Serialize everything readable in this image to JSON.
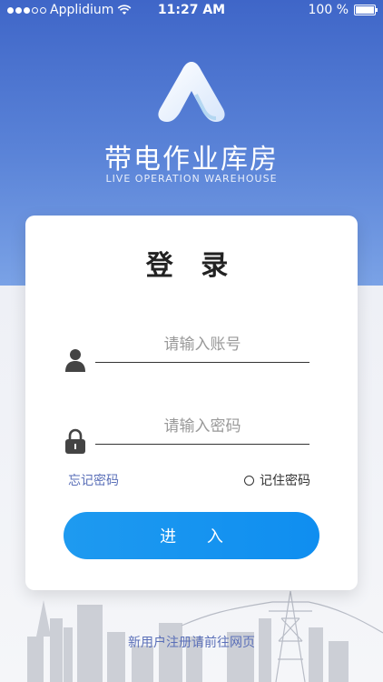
{
  "status_bar": {
    "carrier": "Applidium",
    "time": "11:27 AM",
    "battery": "100 %",
    "icons": [
      "signal-dots",
      "wifi-icon",
      "battery-icon"
    ]
  },
  "branding": {
    "title": "带电作业库房",
    "subtitle": "LIVE OPERATION WAREHOUSE"
  },
  "login": {
    "title": "登 录",
    "username_placeholder": "请输入账号",
    "password_placeholder": "请输入密码",
    "forgot_label": "忘记密码",
    "remember_label": "记住密码",
    "enter_label": "进 入"
  },
  "footer": {
    "register_label": "新用户注册请前往网页"
  },
  "colors": {
    "header_blue": "#3f66c8",
    "button_blue": "#1e9af0",
    "link_color": "#5a6fb8"
  }
}
